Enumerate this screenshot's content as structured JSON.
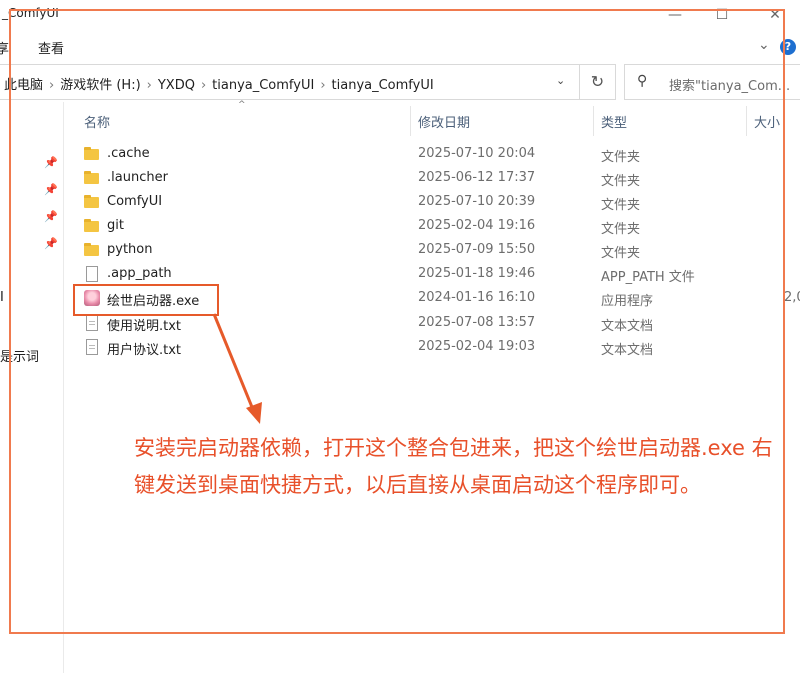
{
  "window": {
    "title": "_ComfyUI",
    "min_glyph": "—",
    "max_glyph": "☐",
    "close_glyph": "✕"
  },
  "ribbon": {
    "tab_cut": "享",
    "tab_view": "查看",
    "expand_glyph": "⌄",
    "help_glyph": "?"
  },
  "address": {
    "crumbs": [
      "此电脑",
      "游戏软件 (H:)",
      "YXDQ",
      "tianya_ComfyUI",
      "tianya_ComfyUI"
    ],
    "dropdown_glyph": "⌄",
    "refresh_glyph": "↻"
  },
  "search": {
    "icon_glyph": "⚲",
    "placeholder": "搜索\"tianya_Com..."
  },
  "nav": {
    "pin_glyph": "📌",
    "frag1": "I",
    "frag2": "是示词"
  },
  "columns": {
    "name": "名称",
    "date": "修改日期",
    "type": "类型",
    "size": "大小",
    "sort_glyph": "^"
  },
  "files": [
    {
      "name": ".cache",
      "date": "2025-07-10 20:04",
      "type": "文件夹",
      "size": "",
      "icon": "folder-icon"
    },
    {
      "name": ".launcher",
      "date": "2025-06-12 17:37",
      "type": "文件夹",
      "size": "",
      "icon": "folder-icon"
    },
    {
      "name": "ComfyUI",
      "date": "2025-07-10 20:39",
      "type": "文件夹",
      "size": "",
      "icon": "folder-icon"
    },
    {
      "name": "git",
      "date": "2025-02-04 19:16",
      "type": "文件夹",
      "size": "",
      "icon": "folder-icon"
    },
    {
      "name": "python",
      "date": "2025-07-09 15:50",
      "type": "文件夹",
      "size": "",
      "icon": "folder-icon"
    },
    {
      "name": ".app_path",
      "date": "2025-01-18 19:46",
      "type": "APP_PATH 文件",
      "size": "",
      "icon": "file-icon"
    },
    {
      "name": "绘世启动器.exe",
      "date": "2024-01-16 16:10",
      "type": "应用程序",
      "size": "2,0",
      "icon": "app-icon"
    },
    {
      "name": "使用说明.txt",
      "date": "2025-07-08 13:57",
      "type": "文本文档",
      "size": "",
      "icon": "text-file-icon"
    },
    {
      "name": "用户协议.txt",
      "date": "2025-02-04 19:03",
      "type": "文本文档",
      "size": "",
      "icon": "text-file-icon"
    }
  ],
  "annotation": {
    "text": "安装完启动器依赖，打开这个整合包进来，把这个绘世启动器.exe 右键发送到桌面快捷方式，以后直接从桌面启动这个程序即可。",
    "color": "#e8502a"
  },
  "colors": {
    "annotation_box": "#f07a4e",
    "highlight_box": "#e65a2a",
    "folder": "#f4c542",
    "column_header": "#4c607a"
  }
}
